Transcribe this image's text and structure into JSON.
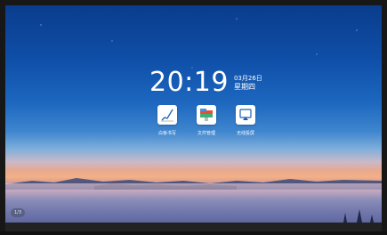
{
  "clock": {
    "time": "20:19",
    "date": "03月26日",
    "weekday": "星期四"
  },
  "apps": [
    {
      "label": "白板书写",
      "icon": "whiteboard-icon"
    },
    {
      "label": "文件管理",
      "icon": "file-manager-icon"
    },
    {
      "label": "无线投屏",
      "icon": "screen-cast-icon"
    }
  ],
  "corner_bubble": {
    "text": "1/3"
  },
  "colors": {
    "sky_top": "#0a3c8c",
    "sunset": "#f3b087",
    "text": "#ffffff"
  }
}
